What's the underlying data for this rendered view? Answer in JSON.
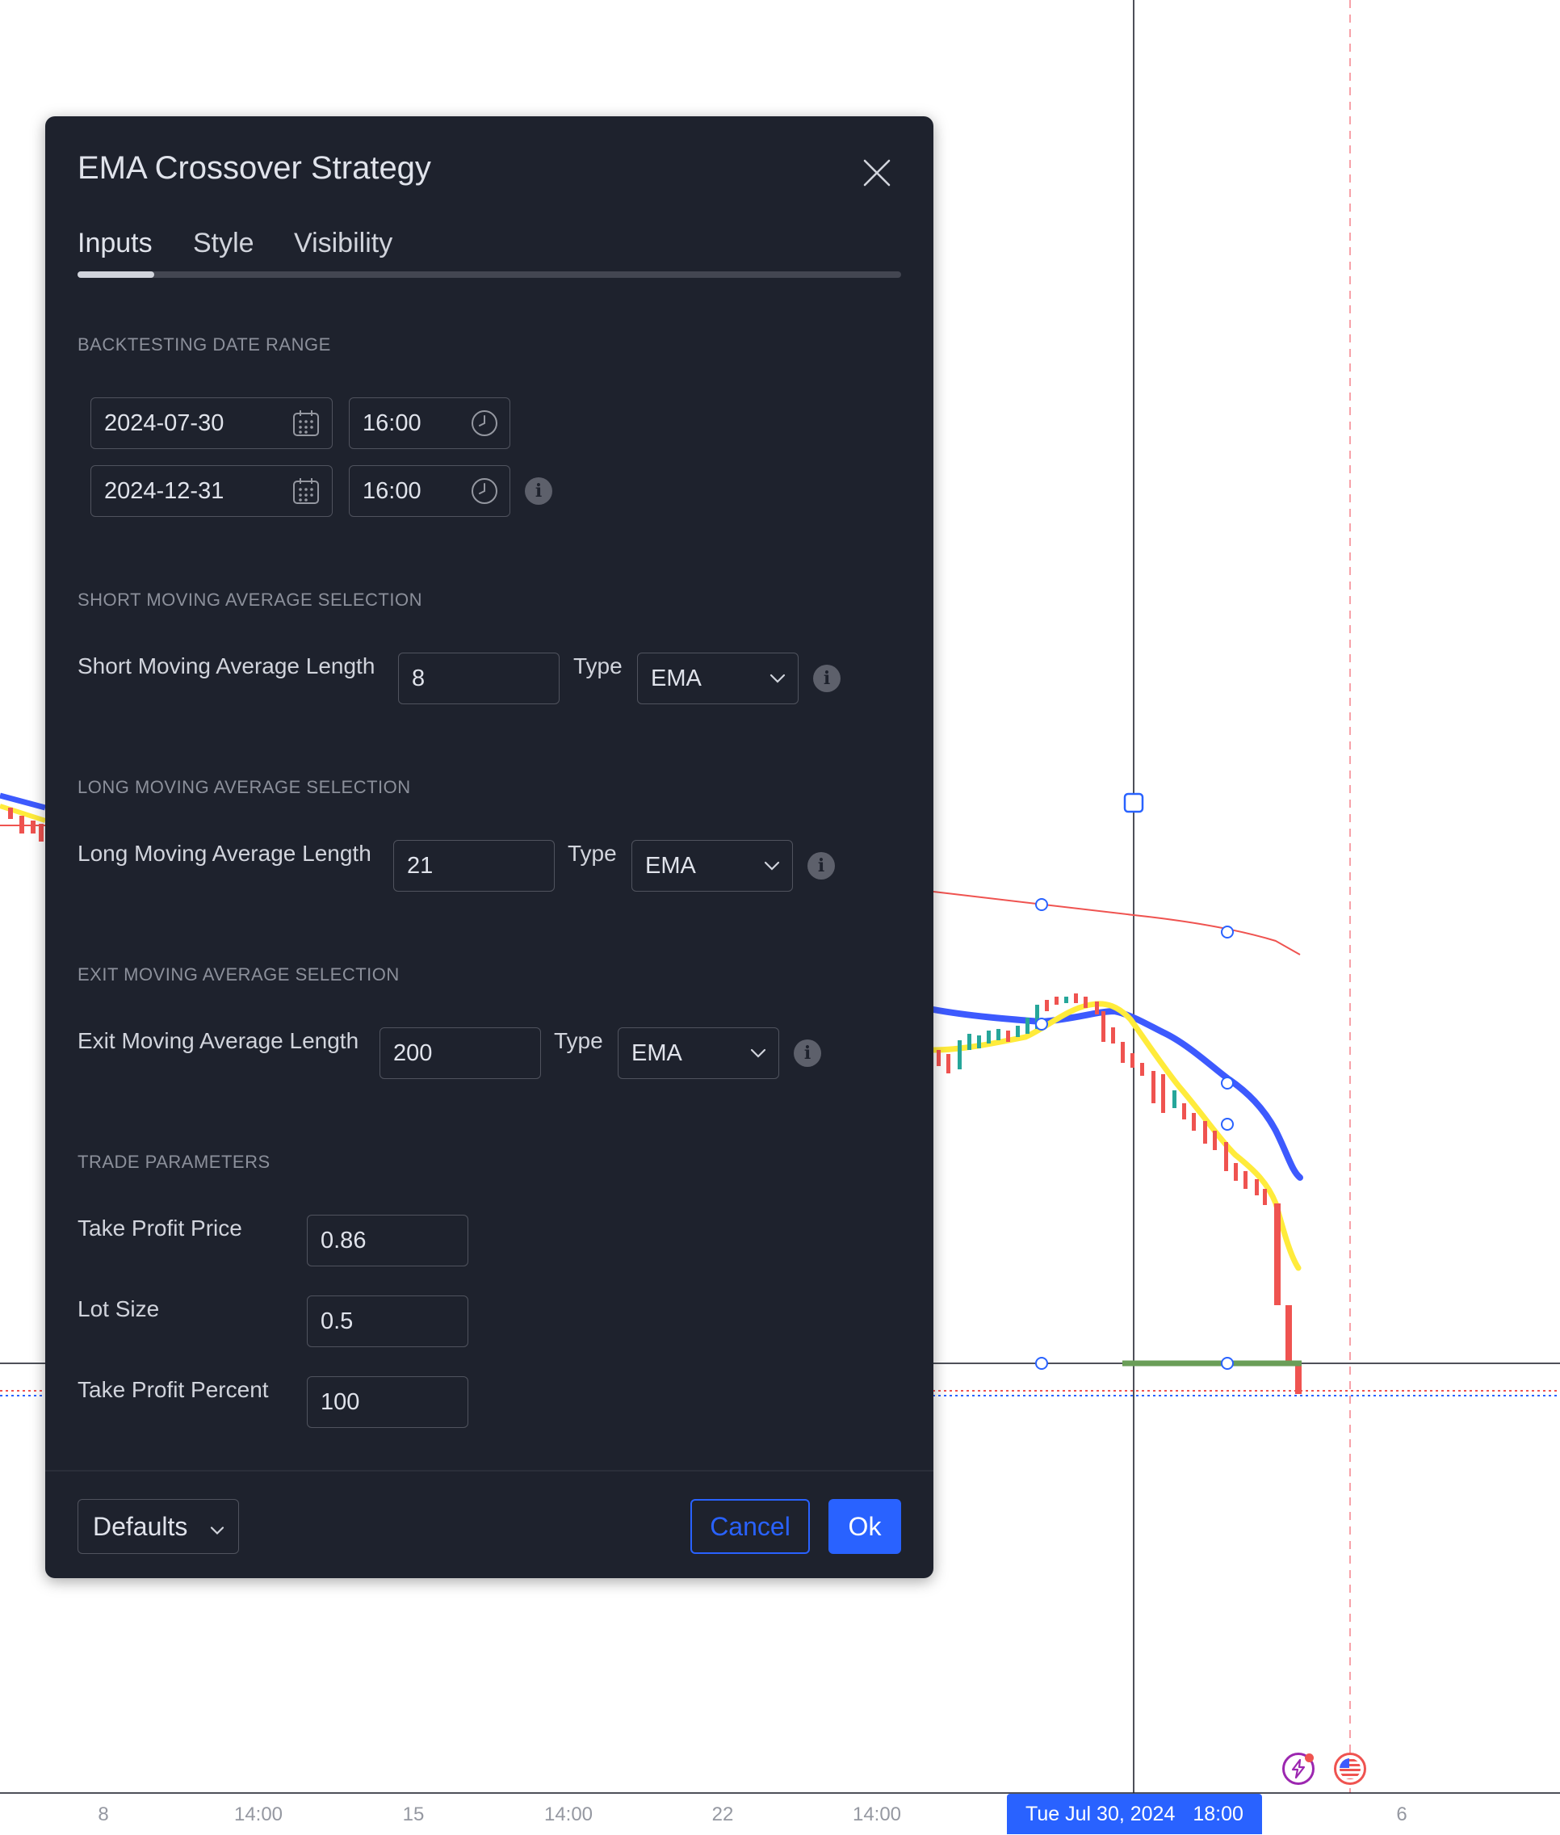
{
  "dialog": {
    "title": "EMA Crossover Strategy",
    "tabs": [
      {
        "label": "Inputs",
        "active": true
      },
      {
        "label": "Style",
        "active": false
      },
      {
        "label": "Visibility",
        "active": false
      }
    ],
    "sections": {
      "backtesting": {
        "title": "BACKTESTING DATE RANGE",
        "start_date": "2024-07-30",
        "start_time": "16:00",
        "end_date": "2024-12-31",
        "end_time": "16:00"
      },
      "short_ma": {
        "title": "SHORT MOVING AVERAGE SELECTION",
        "label": "Short Moving Average Length",
        "value": "8",
        "type_label": "Type",
        "type_value": "EMA"
      },
      "long_ma": {
        "title": "LONG MOVING AVERAGE SELECTION",
        "label": "Long Moving Average Length",
        "value": "21",
        "type_label": "Type",
        "type_value": "EMA"
      },
      "exit_ma": {
        "title": "EXIT MOVING AVERAGE SELECTION",
        "label": "Exit Moving Average Length",
        "value": "200",
        "type_label": "Type",
        "type_value": "EMA"
      },
      "trade": {
        "title": "TRADE PARAMETERS",
        "take_profit_price_label": "Take Profit Price",
        "take_profit_price": "0.86",
        "lot_size_label": "Lot Size",
        "lot_size": "0.5",
        "take_profit_percent_label": "Take Profit Percent",
        "take_profit_percent": "100"
      }
    },
    "footer": {
      "defaults_label": "Defaults",
      "cancel_label": "Cancel",
      "ok_label": "Ok"
    }
  },
  "chart": {
    "time_axis": [
      "8",
      "14:00",
      "15",
      "14:00",
      "22",
      "14:00",
      "6"
    ],
    "crosshair_date": "Tue Jul 30, 2024",
    "crosshair_time": "18:00",
    "colors": {
      "short_ema": "#ffeb3b",
      "long_ema": "#3d5afe",
      "exit_ema": "#f44336",
      "up_candle": "#26a69a",
      "down_candle": "#ef5350",
      "take_profit": "#4caf50",
      "accent": "#2962ff"
    },
    "badges": [
      "lightning-icon",
      "us-flag-icon"
    ]
  }
}
